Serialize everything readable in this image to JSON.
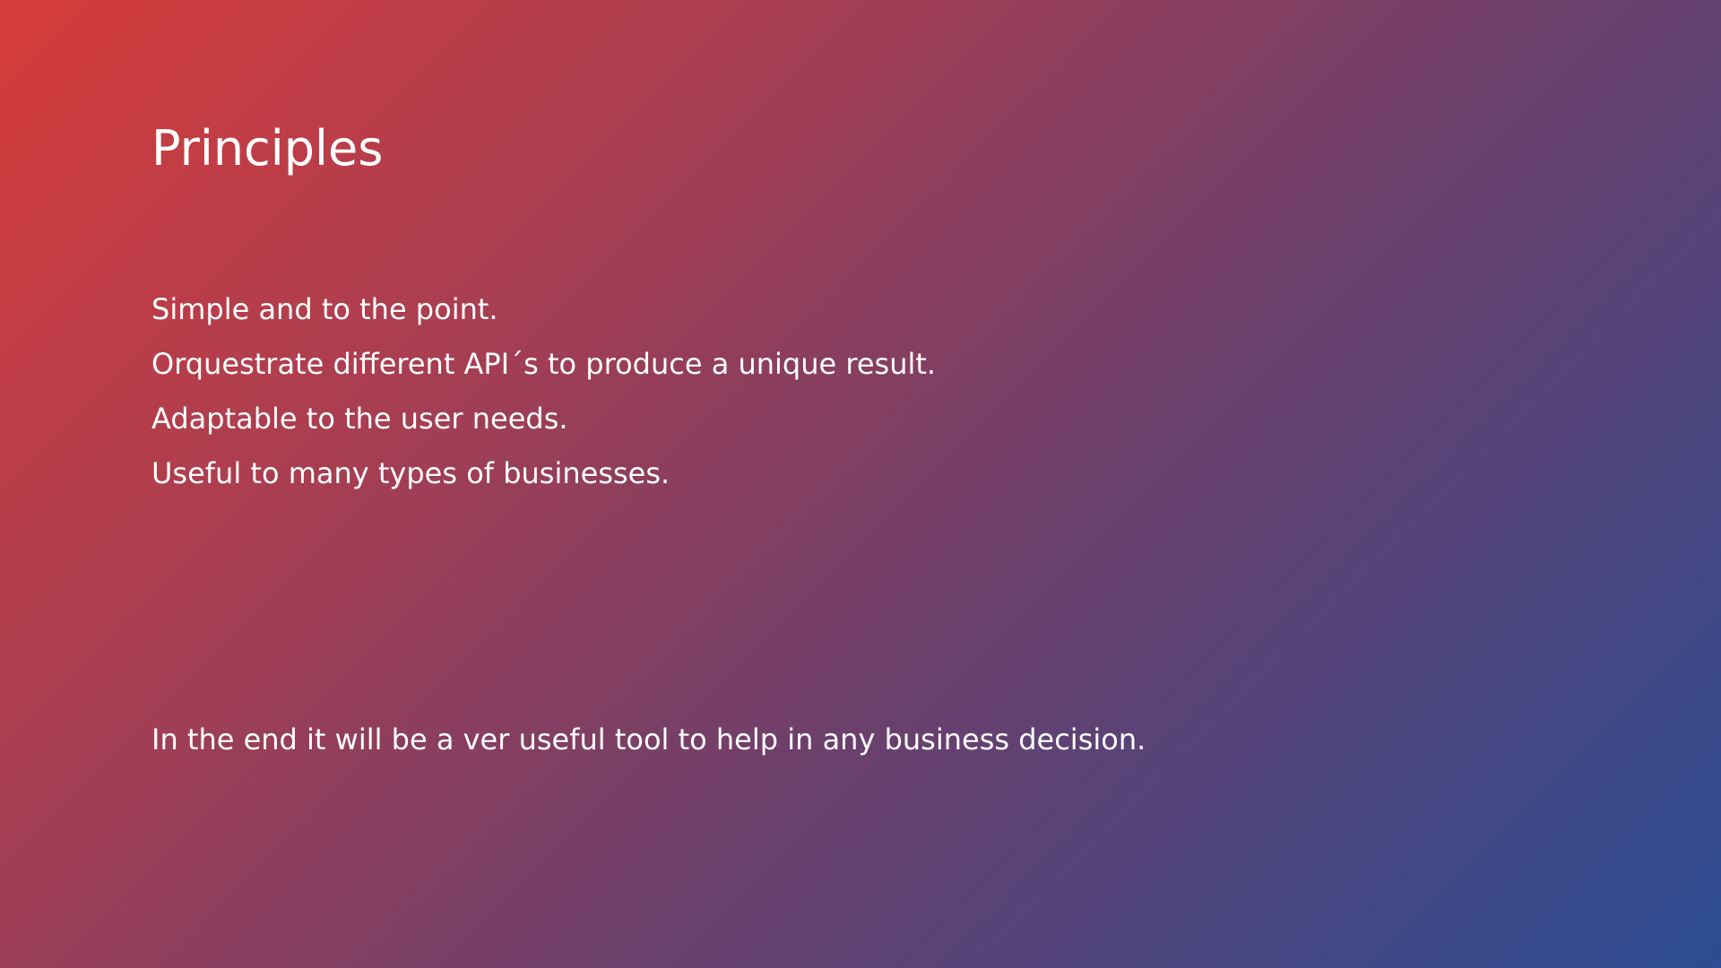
{
  "slide": {
    "title": "Principles",
    "principles": [
      "Simple and to the point.",
      "Orquestrate different API´s to produce a unique result.",
      "Adaptable to the user needs.",
      "Useful to many types of businesses."
    ],
    "conclusion": "In the end it will be a ver useful tool to help in any business decision."
  },
  "colors": {
    "gradient_start": "#d63c3a",
    "gradient_end": "#2b4c93",
    "text": "#ffffff"
  }
}
